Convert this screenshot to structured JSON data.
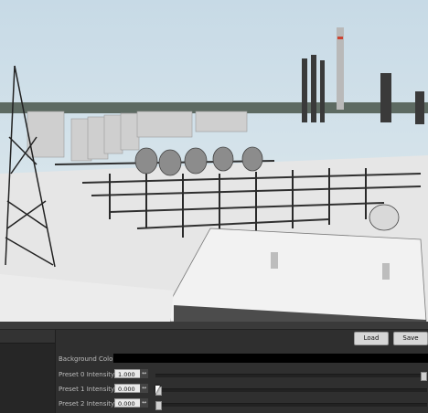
{
  "toolbar": {
    "load_label": "Load",
    "save_label": "Save"
  },
  "settings": {
    "background_color_label": "Background Color",
    "background_color_value": "#000000",
    "presets": [
      {
        "label": "Preset 0 Intensity",
        "value": "1.000",
        "level": 1.0
      },
      {
        "label": "Preset 1 Intensity",
        "value": "0.000",
        "level": 0.0
      },
      {
        "label": "Preset 2 Intensity",
        "value": "0.000",
        "level": 0.0
      }
    ]
  },
  "icons": {
    "spinner": "↔",
    "cursor": "mouse-cursor-icon"
  },
  "colors": {
    "panel_bg": "#2f2f2f",
    "button_bg": "#d7d7d7",
    "sky": "#cfe0ea",
    "snow": "#e8e8e8"
  }
}
